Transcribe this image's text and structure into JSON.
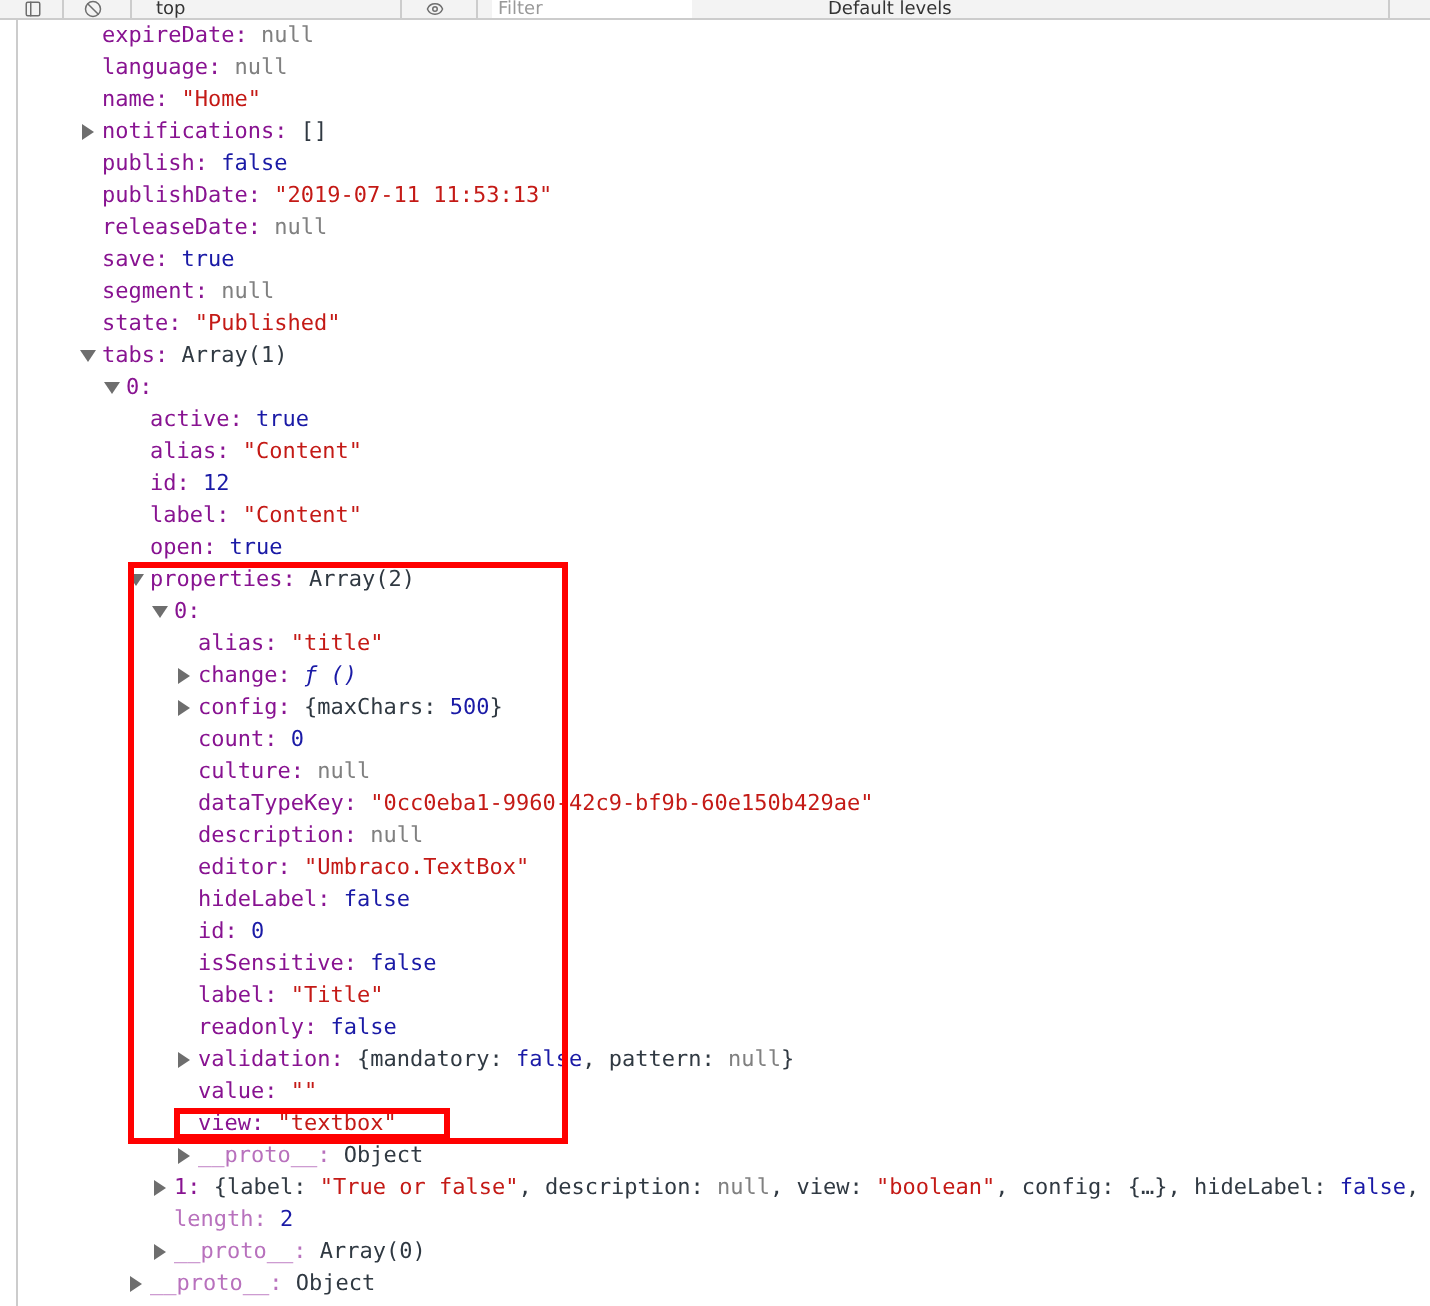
{
  "toolbar": {
    "context": "top",
    "filter": {
      "placeholder": "Filter"
    },
    "levels": "Default levels"
  },
  "tree": [
    {
      "key": "expireDate:",
      "segments": [
        {
          "t": "null",
          "kind": "null"
        }
      ]
    },
    {
      "key": "language:",
      "segments": [
        {
          "t": "null",
          "kind": "null"
        }
      ]
    },
    {
      "key": "name:",
      "segments": [
        {
          "t": "\"Home\"",
          "kind": "string"
        }
      ]
    },
    {
      "key": "notifications:",
      "expanded": false,
      "segments": [
        {
          "t": "[]",
          "kind": "plain"
        }
      ]
    },
    {
      "key": "publish:",
      "segments": [
        {
          "t": "false",
          "kind": "literal"
        }
      ]
    },
    {
      "key": "publishDate:",
      "segments": [
        {
          "t": "\"2019-07-11 11:53:13\"",
          "kind": "string"
        }
      ]
    },
    {
      "key": "releaseDate:",
      "segments": [
        {
          "t": "null",
          "kind": "null"
        }
      ]
    },
    {
      "key": "save:",
      "segments": [
        {
          "t": "true",
          "kind": "literal"
        }
      ]
    },
    {
      "key": "segment:",
      "segments": [
        {
          "t": "null",
          "kind": "null"
        }
      ]
    },
    {
      "key": "state:",
      "segments": [
        {
          "t": "\"Published\"",
          "kind": "string"
        }
      ]
    },
    {
      "key": "tabs:",
      "expanded": true,
      "segments": [
        {
          "t": "Array(1)",
          "kind": "plain"
        }
      ],
      "children": [
        {
          "key": "0:",
          "expanded": true,
          "children": [
            {
              "key": "active:",
              "segments": [
                {
                  "t": "true",
                  "kind": "literal"
                }
              ]
            },
            {
              "key": "alias:",
              "segments": [
                {
                  "t": "\"Content\"",
                  "kind": "string"
                }
              ]
            },
            {
              "key": "id:",
              "segments": [
                {
                  "t": "12",
                  "kind": "literal"
                }
              ]
            },
            {
              "key": "label:",
              "segments": [
                {
                  "t": "\"Content\"",
                  "kind": "string"
                }
              ]
            },
            {
              "key": "open:",
              "segments": [
                {
                  "t": "true",
                  "kind": "literal"
                }
              ]
            },
            {
              "key": "properties:",
              "expanded": true,
              "highlight": {
                "kind": "first_entry"
              },
              "segments": [
                {
                  "t": "Array(2)",
                  "kind": "plain"
                }
              ],
              "children": [
                {
                  "key": "0:",
                  "expanded": true,
                  "children": [
                    {
                      "key": "alias:",
                      "segments": [
                        {
                          "t": "\"title\"",
                          "kind": "string"
                        }
                      ]
                    },
                    {
                      "key": "change:",
                      "expanded": false,
                      "segments": [
                        {
                          "t": "ƒ ()",
                          "kind": "function"
                        }
                      ]
                    },
                    {
                      "key": "config:",
                      "expanded": false,
                      "segments": [
                        {
                          "t": "{maxChars: ",
                          "kind": "plain"
                        },
                        {
                          "t": "500",
                          "kind": "literal"
                        },
                        {
                          "t": "}",
                          "kind": "plain"
                        }
                      ]
                    },
                    {
                      "key": "count:",
                      "segments": [
                        {
                          "t": "0",
                          "kind": "literal"
                        }
                      ]
                    },
                    {
                      "key": "culture:",
                      "segments": [
                        {
                          "t": "null",
                          "kind": "null"
                        }
                      ]
                    },
                    {
                      "key": "dataTypeKey:",
                      "segments": [
                        {
                          "t": "\"0cc0eba1-9960-42c9-bf9b-60e150b429ae\"",
                          "kind": "string"
                        }
                      ]
                    },
                    {
                      "key": "description:",
                      "segments": [
                        {
                          "t": "null",
                          "kind": "null"
                        }
                      ]
                    },
                    {
                      "key": "editor:",
                      "segments": [
                        {
                          "t": "\"Umbraco.TextBox\"",
                          "kind": "string"
                        }
                      ]
                    },
                    {
                      "key": "hideLabel:",
                      "segments": [
                        {
                          "t": "false",
                          "kind": "literal"
                        }
                      ]
                    },
                    {
                      "key": "id:",
                      "segments": [
                        {
                          "t": "0",
                          "kind": "literal"
                        }
                      ]
                    },
                    {
                      "key": "isSensitive:",
                      "segments": [
                        {
                          "t": "false",
                          "kind": "literal"
                        }
                      ]
                    },
                    {
                      "key": "label:",
                      "segments": [
                        {
                          "t": "\"Title\"",
                          "kind": "string"
                        }
                      ]
                    },
                    {
                      "key": "readonly:",
                      "segments": [
                        {
                          "t": "false",
                          "kind": "literal"
                        }
                      ]
                    },
                    {
                      "key": "validation:",
                      "expanded": false,
                      "segments": [
                        {
                          "t": "{mandatory: ",
                          "kind": "plain"
                        },
                        {
                          "t": "false",
                          "kind": "literal"
                        },
                        {
                          "t": ", pattern: ",
                          "kind": "plain"
                        },
                        {
                          "t": "null",
                          "kind": "null"
                        },
                        {
                          "t": "}",
                          "kind": "plain"
                        }
                      ]
                    },
                    {
                      "key": "value:",
                      "segments": [
                        {
                          "t": "\"\"",
                          "kind": "string"
                        }
                      ]
                    },
                    {
                      "key": "view:",
                      "highlight": {
                        "kind": "row"
                      },
                      "segments": [
                        {
                          "t": "\"textbox\"",
                          "kind": "string"
                        }
                      ]
                    },
                    {
                      "key": "__proto__:",
                      "dim": true,
                      "expanded": false,
                      "segments": [
                        {
                          "t": "Object",
                          "kind": "plain"
                        }
                      ]
                    }
                  ]
                },
                {
                  "key": "1:",
                  "expanded": false,
                  "segments": [
                    {
                      "t": "{label: ",
                      "kind": "plain"
                    },
                    {
                      "t": "\"True or false\"",
                      "kind": "string"
                    },
                    {
                      "t": ", description: ",
                      "kind": "plain"
                    },
                    {
                      "t": "null",
                      "kind": "null"
                    },
                    {
                      "t": ", view: ",
                      "kind": "plain"
                    },
                    {
                      "t": "\"boolean\"",
                      "kind": "string"
                    },
                    {
                      "t": ", config: {…}, hideLabel: ",
                      "kind": "plain"
                    },
                    {
                      "t": "false",
                      "kind": "literal"
                    },
                    {
                      "t": ",",
                      "kind": "plain"
                    }
                  ]
                },
                {
                  "key": "length:",
                  "dim": true,
                  "segments": [
                    {
                      "t": "2",
                      "kind": "literal"
                    }
                  ]
                },
                {
                  "key": "__proto__:",
                  "dim": true,
                  "expanded": false,
                  "segments": [
                    {
                      "t": "Array(0)",
                      "kind": "plain"
                    }
                  ]
                }
              ]
            },
            {
              "key": "__proto__:",
              "dim": true,
              "expanded": false,
              "segments": [
                {
                  "t": "Object",
                  "kind": "plain"
                }
              ]
            }
          ]
        }
      ]
    }
  ]
}
